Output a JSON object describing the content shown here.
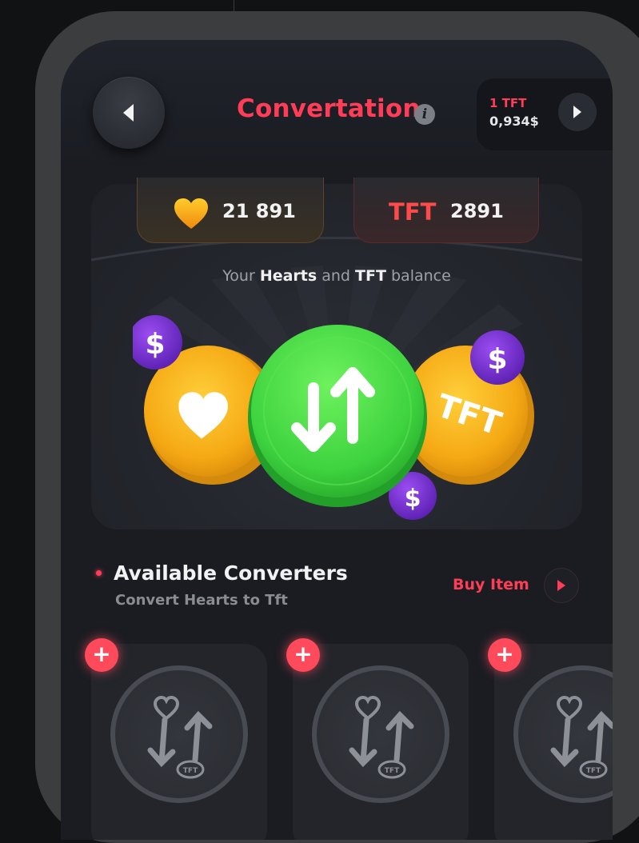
{
  "header": {
    "title": "Convertation",
    "info_icon": "info-icon",
    "back_icon": "chevron-left-icon",
    "rate_line1": "1 TFT",
    "rate_line2": "0,934$",
    "forward_icon": "chevron-right-icon"
  },
  "balance": {
    "hearts_value": "21 891",
    "tft_label": "TFT",
    "tft_value": "2891",
    "caption_pre": "Your",
    "caption_hearts": "Hearts",
    "caption_and": "and",
    "caption_tft": "TFT",
    "caption_post": "balance"
  },
  "hero": {
    "coin_text": "TFT",
    "dollar_symbol": "$",
    "convert_icon": "convert-arrows-icon"
  },
  "converters": {
    "title": "Available Converters",
    "subtitle": "Convert Hearts to Tft",
    "buy_label": "Buy Item",
    "items": [
      {
        "tag": "TFT"
      },
      {
        "tag": "TFT"
      },
      {
        "tag": "TFT"
      }
    ]
  },
  "colors": {
    "accent": "#ff3d57",
    "gold": "#f7b21a",
    "green": "#3fd14a",
    "purple": "#7a2fd6",
    "background": "#1a1c22"
  }
}
